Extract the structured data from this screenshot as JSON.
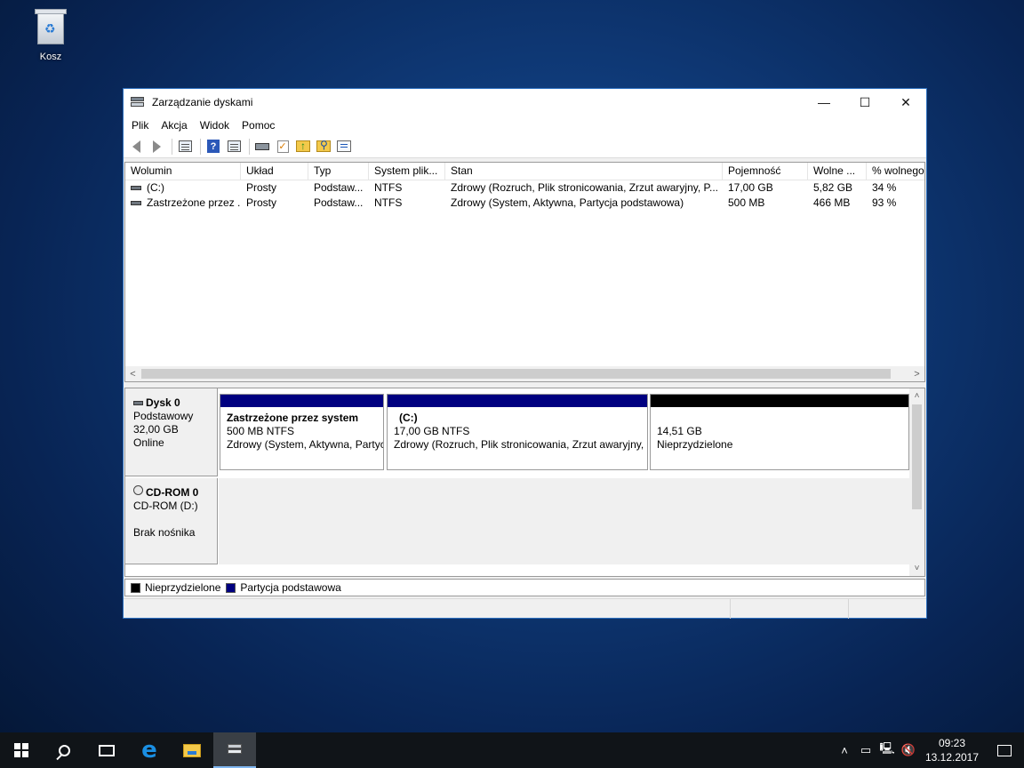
{
  "desktop": {
    "recycle_bin_label": "Kosz"
  },
  "window": {
    "title": "Zarządzanie dyskami",
    "controls": {
      "minimize": "—",
      "maximize": "☐",
      "close": "✕"
    },
    "menu": [
      "Plik",
      "Akcja",
      "Widok",
      "Pomoc"
    ]
  },
  "volume_list": {
    "columns": [
      "Wolumin",
      "Układ",
      "Typ",
      "System plik...",
      "Stan",
      "Pojemność",
      "Wolne ...",
      "% wolnego"
    ],
    "rows": [
      {
        "volume": "(C:)",
        "layout": "Prosty",
        "type": "Podstaw...",
        "fs": "NTFS",
        "status": "Zdrowy (Rozruch, Plik stronicowania, Zrzut awaryjny, P...",
        "capacity": "17,00 GB",
        "free": "5,82 GB",
        "pct_free": "34 %"
      },
      {
        "volume": "Zastrzeżone przez ...",
        "layout": "Prosty",
        "type": "Podstaw...",
        "fs": "NTFS",
        "status": "Zdrowy (System, Aktywna, Partycja podstawowa)",
        "capacity": "500 MB",
        "free": "466 MB",
        "pct_free": "93 %"
      }
    ],
    "scroll_left": "<",
    "scroll_right": ">"
  },
  "disks": {
    "disk0": {
      "name": "Dysk 0",
      "type": "Podstawowy",
      "size": "32,00 GB",
      "state": "Online",
      "partitions": [
        {
          "name": "Zastrzeżone przez system",
          "size": "500 MB NTFS",
          "status": "Zdrowy (System, Aktywna, Partycja podstawowa)",
          "kind": "primary"
        },
        {
          "name": "(C:)",
          "size": "17,00 GB NTFS",
          "status": "Zdrowy (Rozruch, Plik stronicowania, Zrzut awaryjny, Partycja podstawowa)",
          "kind": "primary"
        },
        {
          "name": "",
          "size": "14,51 GB",
          "status": "Nieprzydzielone",
          "kind": "unallocated"
        }
      ]
    },
    "cdrom0": {
      "name": "CD-ROM 0",
      "drive": "CD-ROM (D:)",
      "media": "Brak nośnika"
    },
    "scroll_up": "˄",
    "scroll_down": "˅"
  },
  "legend": {
    "unallocated": "Nieprzydzielone",
    "primary": "Partycja podstawowa"
  },
  "colors": {
    "primary_partition": "#000080",
    "unallocated": "#000000",
    "window_accent": "#2c6fbf"
  },
  "taskbar": {
    "icons": [
      "windows-start-icon",
      "search-icon",
      "task-view-icon",
      "edge-icon",
      "file-explorer-icon",
      "disk-management-icon"
    ],
    "tray": {
      "chevron": "˄",
      "time": "09:23",
      "date": "13.12.2017"
    }
  }
}
